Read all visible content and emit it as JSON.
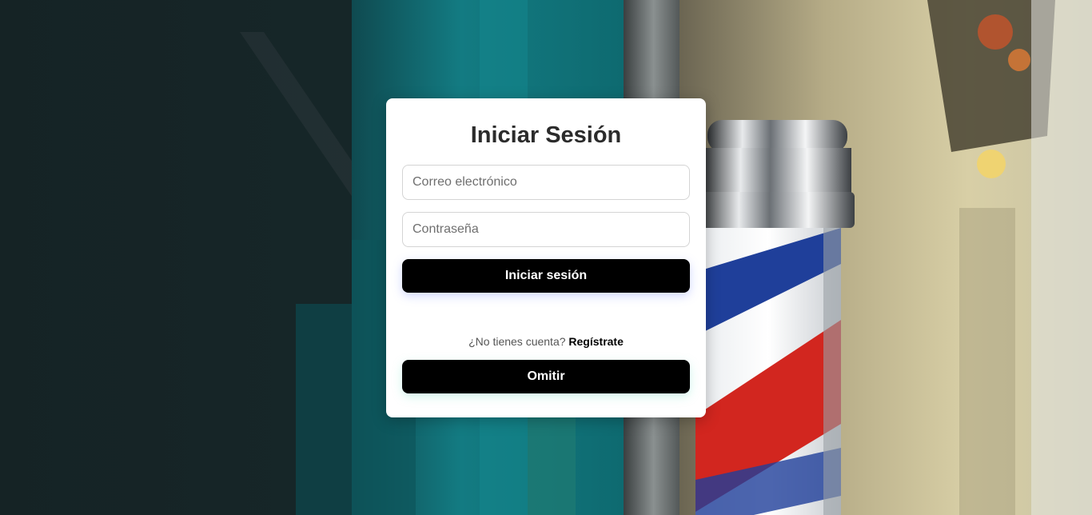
{
  "login_card": {
    "title": "Iniciar Sesión",
    "email_placeholder": "Correo electrónico",
    "password_placeholder": "Contraseña",
    "login_button_label": "Iniciar sesión",
    "no_account_text": "¿No tienes cuenta?",
    "register_link_label": "Regístrate",
    "skip_button_label": "Omitir"
  },
  "colors": {
    "button_bg": "#000000",
    "button_text": "#ffffff",
    "card_bg": "#ffffff",
    "title_text": "#2b2b2b"
  },
  "background": {
    "subject": "barber pole photo"
  }
}
